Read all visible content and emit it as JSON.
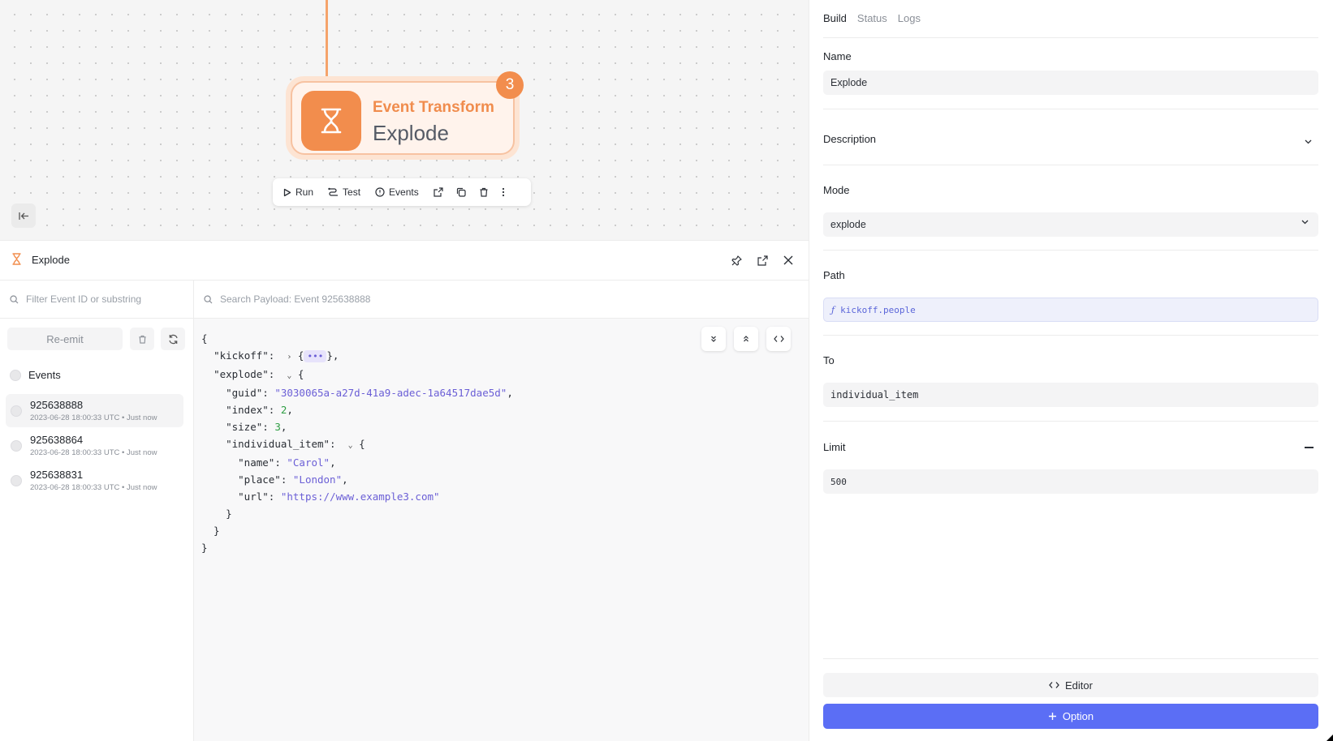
{
  "canvas": {
    "node": {
      "type_label": "Event Transform",
      "name": "Explode",
      "badge_count": "3"
    },
    "toolbar": {
      "run_label": "Run",
      "test_label": "Test",
      "events_label": "Events"
    }
  },
  "panel": {
    "title": "Explode",
    "filter_placeholder": "Filter Event ID or substring",
    "payload_search_placeholder": "Search Payload: Event 925638888",
    "reemit_label": "Re-emit",
    "events_heading": "Events",
    "events": [
      {
        "id": "925638888",
        "meta": "2023-06-28 18:00:33 UTC  •  Just now"
      },
      {
        "id": "925638864",
        "meta": "2023-06-28 18:00:33 UTC  •  Just now"
      },
      {
        "id": "925638831",
        "meta": "2023-06-28 18:00:33 UTC  •  Just now"
      }
    ],
    "payload": {
      "kickoff_key": "\"kickoff\"",
      "explode_key": "\"explode\"",
      "guid_key": "\"guid\"",
      "guid_val": "\"3030065a-a27d-41a9-adec-1a64517dae5d\"",
      "index_key": "\"index\"",
      "index_val": "2",
      "size_key": "\"size\"",
      "size_val": "3",
      "item_key": "\"individual_item\"",
      "name_key": "\"name\"",
      "name_val": "\"Carol\"",
      "place_key": "\"place\"",
      "place_val": "\"London\"",
      "url_key": "\"url\"",
      "url_val": "\"https://www.example3.com\""
    }
  },
  "right": {
    "tabs": [
      "Build",
      "Status",
      "Logs"
    ],
    "name_label": "Name",
    "name_value": "Explode",
    "description_label": "Description",
    "mode_label": "Mode",
    "mode_value": "explode",
    "path_label": "Path",
    "path_value": "kickoff.people",
    "to_label": "To",
    "to_value": "individual_item",
    "limit_label": "Limit",
    "limit_value": "500",
    "editor_label": "Editor",
    "option_label": "Option"
  },
  "colors": {
    "accent": "#5b6ef5",
    "node_orange": "#f28d4d",
    "string": "#6b5fd6",
    "number": "#2f9e44"
  }
}
